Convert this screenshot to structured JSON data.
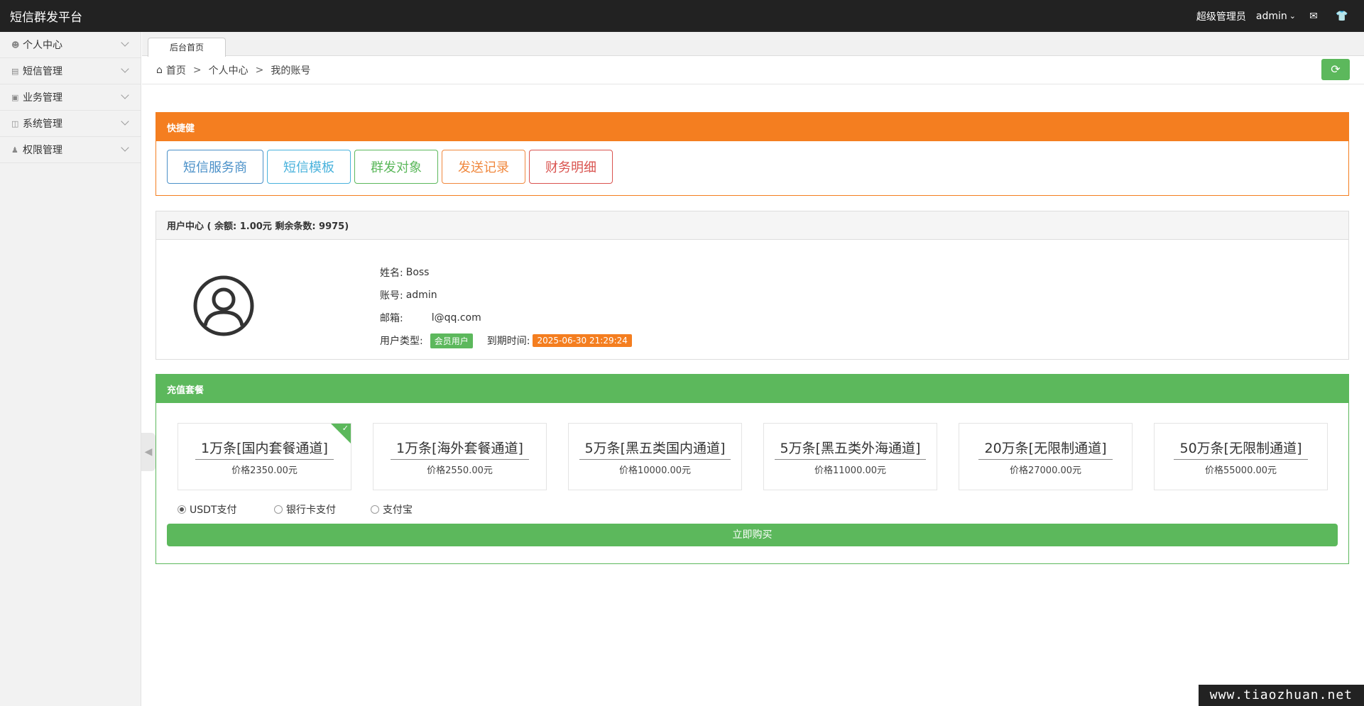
{
  "app": {
    "title": "短信群发平台"
  },
  "topbar": {
    "role": "超级管理员",
    "username": "admin"
  },
  "sidebar": {
    "items": [
      {
        "label": "个人中心",
        "icon": "user-icon"
      },
      {
        "label": "短信管理",
        "icon": "list-icon"
      },
      {
        "label": "业务管理",
        "icon": "card-icon"
      },
      {
        "label": "系统管理",
        "icon": "database-icon"
      },
      {
        "label": "权限管理",
        "icon": "users-icon"
      }
    ]
  },
  "tabs": [
    {
      "label": "后台首页"
    }
  ],
  "breadcrumb": {
    "home": "首页",
    "level1": "个人中心",
    "current": "我的账号"
  },
  "quick": {
    "title": "快捷健",
    "buttons": [
      "短信服务商",
      "短信模板",
      "群发对象",
      "发送记录",
      "财务明细"
    ]
  },
  "user": {
    "header": "用户中心 ( 余额: 1.00元 剩余条数:  9975)",
    "name_label": "姓名:",
    "name": "Boss",
    "account_label": "账号:",
    "account": "admin",
    "email_label": "邮箱:",
    "email": "l@qq.com",
    "type_label": "用户类型:",
    "type_badge": "会员用户",
    "expire_label": "到期时间:",
    "expire_time": "2025-06-30 21:29:24"
  },
  "packages": {
    "title": "充值套餐",
    "items": [
      {
        "name": "1万条[国内套餐通道]",
        "price": "价格2350.00元",
        "selected": true
      },
      {
        "name": "1万条[海外套餐通道]",
        "price": "价格2550.00元",
        "selected": false
      },
      {
        "name": "5万条[黑五类国内通道]",
        "price": "价格10000.00元",
        "selected": false
      },
      {
        "name": "5万条[黑五类外海通道]",
        "price": "价格11000.00元",
        "selected": false
      },
      {
        "name": "20万条[无限制通道]",
        "price": "价格27000.00元",
        "selected": false
      },
      {
        "name": "50万条[无限制通道]",
        "price": "价格55000.00元",
        "selected": false
      }
    ],
    "payments": [
      {
        "label": "USDT支付",
        "selected": true
      },
      {
        "label": "银行卡支付",
        "selected": false
      },
      {
        "label": "支付宝",
        "selected": false
      }
    ],
    "buy_label": "立即购买"
  },
  "watermark": "www.tiaozhuan.net",
  "colors": {
    "orange": "#f47e20",
    "green": "#5cb85c",
    "topbar": "#222222"
  }
}
